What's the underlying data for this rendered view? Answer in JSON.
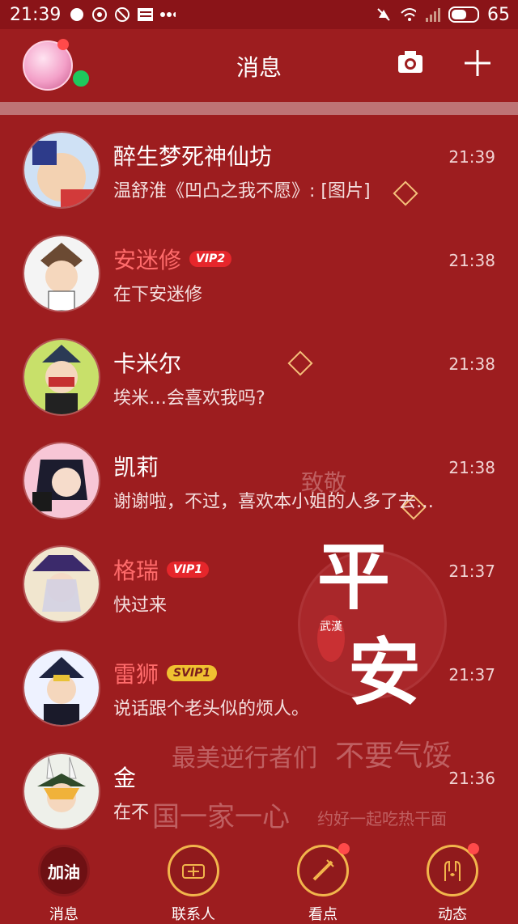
{
  "status_bar": {
    "time": "21:39",
    "battery": "65"
  },
  "header": {
    "title": "消息"
  },
  "conversations": [
    {
      "name": "醉生梦死神仙坊",
      "badge": "",
      "message": "温舒淮《凹凸之我不愿》: [图片]",
      "time": "21:39"
    },
    {
      "name": "安迷修",
      "badge": "VIP2",
      "message": "在下安迷修",
      "time": "21:38"
    },
    {
      "name": "卡米尔",
      "badge": "",
      "message": "埃米…会喜欢我吗?",
      "time": "21:38"
    },
    {
      "name": "凯莉",
      "badge": "",
      "message": "谢谢啦，不过，喜欢本小姐的人多了去…",
      "time": "21:38"
    },
    {
      "name": "格瑞",
      "badge": "VIP1",
      "message": "快过来",
      "time": "21:37"
    },
    {
      "name": "雷狮",
      "badge": "SVIP1",
      "message": "说话跟个老头似的烦人。",
      "time": "21:37"
    },
    {
      "name": "金",
      "badge": "",
      "message": "在不",
      "time": "21:36"
    }
  ],
  "background": {
    "deco_text_1": "致敬",
    "deco_text_2": "最美逆行者们",
    "deco_text_3": "不要气馁",
    "deco_text_4": "国一家一心",
    "deco_text_5": "约好一起吃热干面",
    "seal_char_1": "平",
    "seal_char_2": "安",
    "seal_stamp": "武漢"
  },
  "tabs": [
    {
      "label": "消息",
      "icon_text": "加油"
    },
    {
      "label": "联系人"
    },
    {
      "label": "看点"
    },
    {
      "label": "动态"
    }
  ],
  "colors": {
    "background": "#9d1d1f",
    "vip_name": "#ff6b6b",
    "vip_badge": "#e6262b",
    "svip_badge": "#f0c131"
  }
}
